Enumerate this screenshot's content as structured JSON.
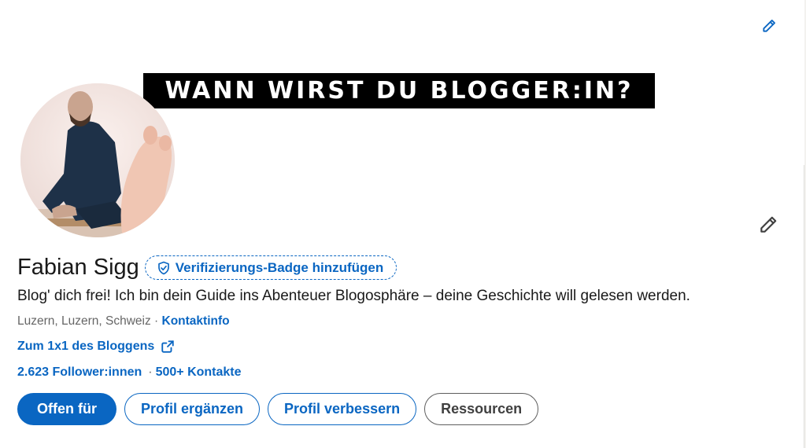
{
  "banner": {
    "headline": "WANN WIRST DU BLOGGER:IN?",
    "edit_icon": "pencil-icon"
  },
  "profile": {
    "name": "Fabian Sigg",
    "verify_badge_label": "Verifizierungs-Badge hinzufügen",
    "verify_icon": "shield-check-icon",
    "headline": "Blog' dich frei! Ich bin dein Guide ins Abenteuer Blogosphäre – deine Geschichte will gelesen werden.",
    "location": "Luzern, Luzern, Schweiz",
    "location_separator": " · ",
    "contact_info_label": "Kontaktinfo",
    "website_label": "Zum 1x1 des Bloggens",
    "website_icon": "external-link-icon",
    "followers_label": "2.623 Follower:innen",
    "stats_separator": "·",
    "connections_label": "500+ Kontakte",
    "edit_icon": "pencil-icon"
  },
  "actions": {
    "open_to": "Offen für",
    "complete_profile": "Profil ergänzen",
    "improve_profile": "Profil verbessern",
    "resources": "Ressourcen"
  },
  "colors": {
    "accent": "#0a66c2",
    "text": "#191919",
    "muted": "#666666",
    "banner_bg": "#000000"
  }
}
